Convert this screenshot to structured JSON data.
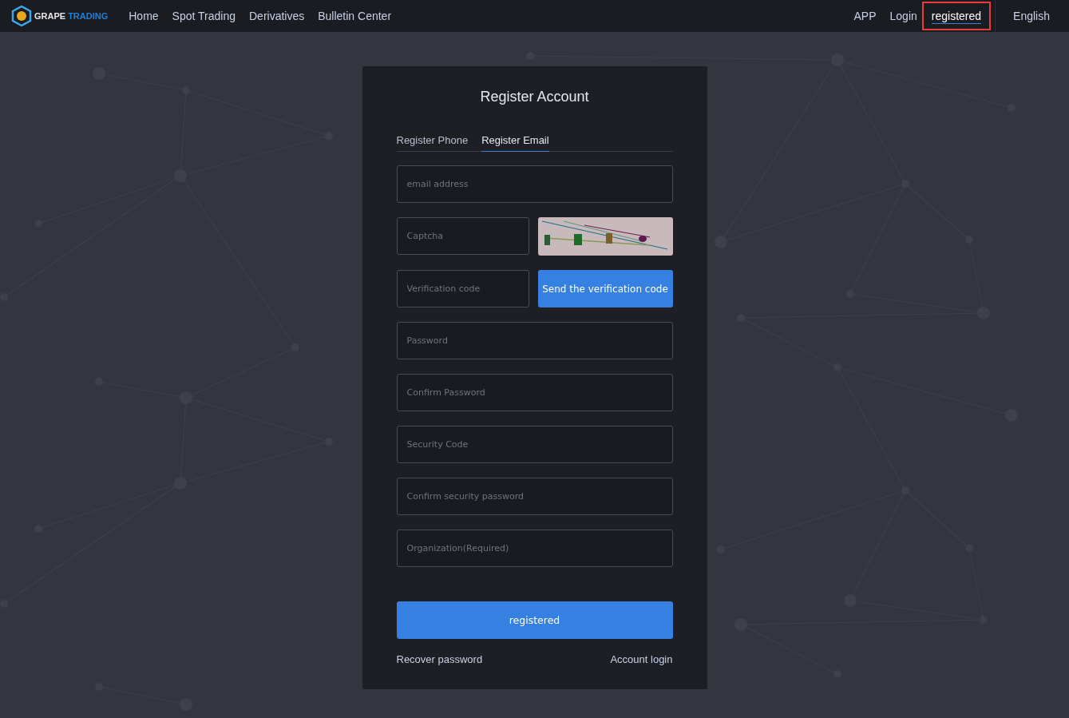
{
  "brand": {
    "name_first": "GRAPE",
    "name_second": "TRADING"
  },
  "nav": [
    {
      "label": "Home"
    },
    {
      "label": "Spot Trading"
    },
    {
      "label": "Derivatives"
    },
    {
      "label": "Bulletin Center"
    }
  ],
  "nav_right": [
    {
      "label": "APP",
      "selected": false
    },
    {
      "label": "Login",
      "selected": false
    },
    {
      "label": "registered",
      "selected": true
    }
  ],
  "language": "English",
  "form": {
    "title": "Register Account",
    "tabs": [
      {
        "label": "Register Phone",
        "selected": false
      },
      {
        "label": "Register Email",
        "selected": true
      }
    ],
    "email": {
      "placeholder": "email address"
    },
    "captcha": {
      "placeholder": "Captcha"
    },
    "verification": {
      "placeholder": "Verification code"
    },
    "send_button": "Send the verification code",
    "fields": [
      {
        "placeholder": "Password"
      },
      {
        "placeholder": "Confirm Password"
      },
      {
        "placeholder": "Security Code"
      },
      {
        "placeholder": "Confirm security password"
      },
      {
        "placeholder": "Organization(Required)"
      }
    ],
    "submit": "registered",
    "links": [
      {
        "label": "Recover password"
      },
      {
        "label": "Account login"
      }
    ]
  }
}
